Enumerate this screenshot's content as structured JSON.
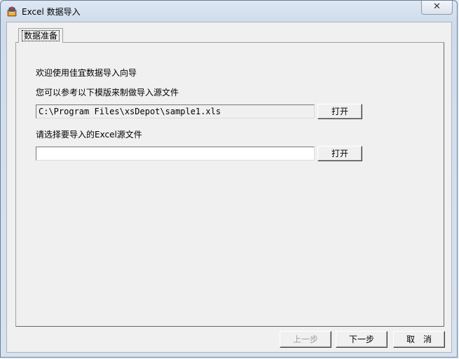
{
  "window": {
    "title": "Excel 数据导入",
    "app_icon": "excel-app-icon",
    "close_glyph": "✕"
  },
  "tab": {
    "label": "数据准备"
  },
  "wizard": {
    "welcome": "欢迎使用佳宜数据导入向导",
    "template_hint": "您可以参考以下模版来制做导入源文件",
    "template_path": "C:\\Program Files\\xsDepot\\sample1.xls",
    "open_template_label": "打开",
    "select_hint": "请选择要导入的Excel源文件",
    "source_path": "",
    "open_source_label": "打开"
  },
  "footer": {
    "prev_label": "上一步",
    "next_label": "下一步",
    "cancel_label": "取　消"
  }
}
